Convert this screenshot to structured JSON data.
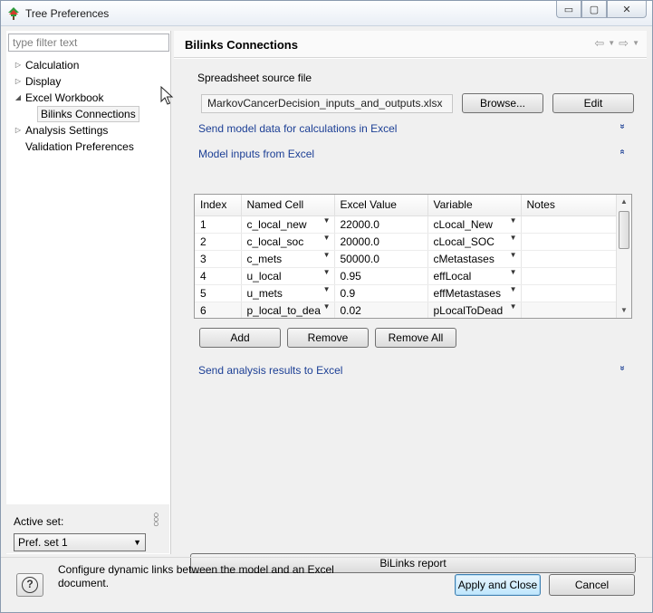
{
  "window": {
    "title": "Tree Preferences",
    "controls": {
      "minimize": "▭",
      "maximize": "▢",
      "close": "✕"
    }
  },
  "sidebar": {
    "filter_placeholder": "type filter text",
    "items": [
      {
        "label": "Calculation",
        "arrow": "▷",
        "level": 0
      },
      {
        "label": "Display",
        "arrow": "▷",
        "level": 0
      },
      {
        "label": "Excel Workbook",
        "arrow": "◢",
        "level": 0
      },
      {
        "label": "Bilinks Connections",
        "arrow": "",
        "level": 1,
        "selected": true
      },
      {
        "label": "Analysis Settings",
        "arrow": "▷",
        "level": 0
      },
      {
        "label": "Validation Preferences",
        "arrow": "",
        "level": 0
      }
    ],
    "active_set_label": "Active set:",
    "active_set_value": "Pref. set 1"
  },
  "page": {
    "title": "Bilinks Connections",
    "spreadsheet_label": "Spreadsheet source file",
    "spreadsheet_file": "MarkovCancerDecision_inputs_and_outputs.xlsx",
    "browse_label": "Browse...",
    "edit_label": "Edit",
    "section_send_model": "Send model data for calculations in Excel",
    "section_inputs": "Model inputs from Excel",
    "section_send_results": "Send analysis results to Excel",
    "chevron_expand": "»",
    "chevron_collapse": "«",
    "add_label": "Add",
    "remove_label": "Remove",
    "remove_all_label": "Remove All",
    "report_label": "BiLinks report"
  },
  "table": {
    "headers": [
      "Index",
      "Named Cell",
      "Excel Value",
      "Variable",
      "Notes"
    ],
    "rows": [
      [
        "1",
        "c_local_new",
        "22000.0",
        "cLocal_New",
        ""
      ],
      [
        "2",
        "c_local_soc",
        "20000.0",
        "cLocal_SOC",
        ""
      ],
      [
        "3",
        "c_mets",
        "50000.0",
        "cMetastases",
        ""
      ],
      [
        "4",
        "u_local",
        "0.95",
        "effLocal",
        ""
      ],
      [
        "5",
        "u_mets",
        "0.9",
        "effMetastases",
        ""
      ],
      [
        "6",
        "p_local_to_dea",
        "0.02",
        "pLocalToDead",
        ""
      ]
    ]
  },
  "footer": {
    "description": "Configure dynamic links between the model and an Excel document.",
    "help_label": "?",
    "apply_label": "Apply and Close",
    "cancel_label": "Cancel"
  },
  "colors": {
    "link": "#1c3f95",
    "window_bg": "#f0f0f0",
    "apply_border": "#3c7fb1"
  }
}
